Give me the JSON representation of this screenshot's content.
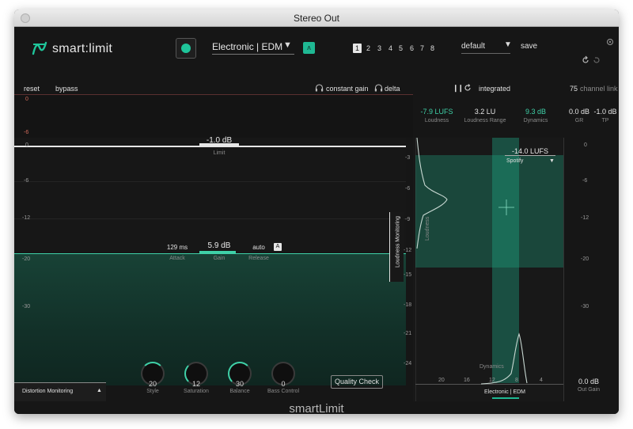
{
  "window": {
    "title": "Stereo Out"
  },
  "header": {
    "app_name": "smart:limit",
    "profile": "Electronic | EDM",
    "slots": [
      "1",
      "2",
      "3",
      "4",
      "5",
      "6",
      "7",
      "8"
    ],
    "active_slot": "1",
    "preset": "default",
    "save_label": "save"
  },
  "toolbar": {
    "reset_label": "reset",
    "bypass_label": "bypass",
    "constant_gain_label": "constant gain",
    "delta_label": "delta",
    "integrated_label": "integrated",
    "channel_link_value": "75",
    "channel_link_label": "channel link"
  },
  "stats": {
    "loudness_value": "-7.9 LUFS",
    "loudness_label": "Loudness",
    "range_value": "3.2 LU",
    "range_label": "Loudness Range",
    "dynamics_value": "9.3 dB",
    "dynamics_label": "Dynamics",
    "gr_value": "0.0 dB",
    "gr_label": "GR",
    "tp_value": "-1.0 dB",
    "tp_label": "TP"
  },
  "gr_meter": {
    "top_label": "0",
    "bottom_label": "-6"
  },
  "limit": {
    "value": "-1.0 dB",
    "label": "Limit"
  },
  "left_scale": [
    "0",
    "-6",
    "-12",
    "-20",
    "-30"
  ],
  "attack": {
    "value": "129 ms",
    "label": "Attack"
  },
  "gain": {
    "value": "5.9 dB",
    "label": "Gain"
  },
  "release": {
    "value": "auto",
    "label": "Release",
    "auto_badge": "A"
  },
  "knobs": [
    {
      "value": "20",
      "label": "Style"
    },
    {
      "value": "12",
      "label": "Saturation"
    },
    {
      "value": "30",
      "label": "Balance"
    },
    {
      "value": "0",
      "label": "Bass Control"
    }
  ],
  "distortion_label": "Distortion Monitoring",
  "quality_check_label": "Quality Check",
  "loudness_monitoring_label": "Loudness Monitoring",
  "target": {
    "value": "-14.0 LUFS",
    "platform": "Spotify"
  },
  "graph": {
    "loudness_axis_label": "Loudness",
    "dynamics_axis_label": "Dynamics",
    "profile_label": "Electronic | EDM",
    "left_axis": [
      "-3",
      "-6",
      "-9",
      "-12",
      "-15",
      "-18",
      "-21",
      "-24"
    ],
    "bottom_axis": [
      "20",
      "16",
      "12",
      "8",
      "4"
    ]
  },
  "out_scale": [
    "0",
    "-6",
    "-12",
    "-20",
    "-30"
  ],
  "out_gain": {
    "value": "0.0 dB",
    "label": "Out Gain"
  },
  "footer": {
    "title": "smartLimit"
  },
  "colors": {
    "accent": "#1fc59a",
    "background": "#161616"
  },
  "icons": [
    "power-icon",
    "undo-icon",
    "redo-icon",
    "headphones-icon",
    "pause-icon",
    "reset-icon",
    "settings-icon"
  ]
}
